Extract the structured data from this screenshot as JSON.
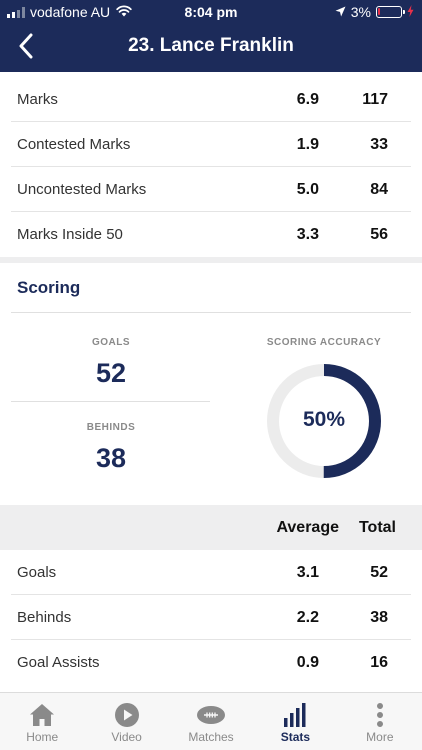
{
  "status_bar": {
    "carrier": "vodafone AU",
    "time": "8:04 pm",
    "battery_percent": "3%",
    "battery_level": 0.03,
    "icons": [
      "signal-icon",
      "wifi-icon",
      "location-arrow-icon",
      "battery-icon",
      "charging-bolt-icon"
    ]
  },
  "header": {
    "title": "23. Lance Franklin",
    "back_icon": "chevron-left-icon"
  },
  "marks_rows": [
    {
      "label": "Marks",
      "average": "6.9",
      "total": "117"
    },
    {
      "label": "Contested Marks",
      "average": "1.9",
      "total": "33"
    },
    {
      "label": "Uncontested Marks",
      "average": "5.0",
      "total": "84"
    },
    {
      "label": "Marks Inside 50",
      "average": "3.3",
      "total": "56"
    }
  ],
  "scoring": {
    "title": "Scoring",
    "goals_label": "GOALS",
    "goals_value": "52",
    "behinds_label": "BEHINDS",
    "behinds_value": "38",
    "accuracy_label": "SCORING ACCURACY",
    "accuracy_text": "50%",
    "accuracy_fraction": 0.5
  },
  "table_header": {
    "average": "Average",
    "total": "Total"
  },
  "scoring_rows": [
    {
      "label": "Goals",
      "average": "3.1",
      "total": "52"
    },
    {
      "label": "Behinds",
      "average": "2.2",
      "total": "38"
    },
    {
      "label": "Goal Assists",
      "average": "0.9",
      "total": "16"
    }
  ],
  "tabs": [
    {
      "label": "Home",
      "icon": "home-icon"
    },
    {
      "label": "Video",
      "icon": "play-icon"
    },
    {
      "label": "Matches",
      "icon": "football-icon"
    },
    {
      "label": "Stats",
      "icon": "bar-chart-icon",
      "active": true
    },
    {
      "label": "More",
      "icon": "more-dots-icon"
    }
  ],
  "colors": {
    "brand_navy": "#1c2b5a",
    "battery_low": "#e8304a",
    "donut_track": "#ececec",
    "inactive_tab": "#8a8a8a"
  }
}
